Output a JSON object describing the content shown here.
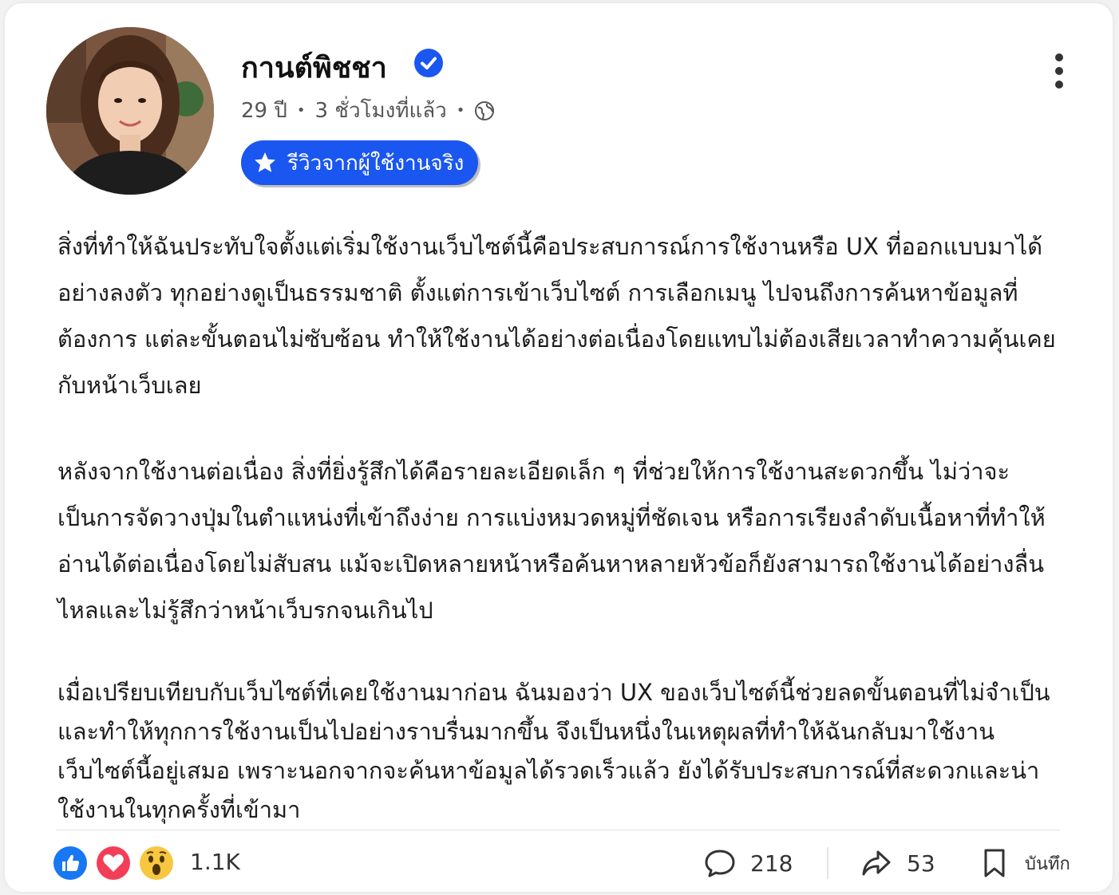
{
  "post": {
    "author_name": "กานต์พิชชา",
    "age": "29 ปี",
    "time_ago": "3 ชั่วโมงที่แล้ว",
    "separator": "•",
    "badge_label": "รีวิวจากผู้ใช้งานจริง",
    "paragraphs": [
      "สิ่งที่ทำให้ฉันประทับใจตั้งแต่เริ่มใช้งานเว็บไซต์นี้คือประสบการณ์การใช้งานหรือ UX ที่ออกแบบมาได้อย่างลงตัว ทุกอย่างดูเป็นธรรมชาติ ตั้งแต่การเข้าเว็บไซต์ การเลือกเมนู ไปจนถึงการค้นหาข้อมูลที่ต้องการ แต่ละขั้นตอนไม่ซับซ้อน ทำให้ใช้งานได้อย่างต่อเนื่องโดยแทบไม่ต้องเสียเวลาทำความคุ้นเคยกับหน้าเว็บเลย",
      "หลังจากใช้งานต่อเนื่อง สิ่งที่ยิ่งรู้สึกได้คือรายละเอียดเล็ก ๆ ที่ช่วยให้การใช้งานสะดวกขึ้น ไม่ว่าจะเป็นการจัดวางปุ่มในตำแหน่งที่เข้าถึงง่าย การแบ่งหมวดหมู่ที่ชัดเจน หรือการเรียงลำดับเนื้อหาที่ทำให้อ่านได้ต่อเนื่องโดยไม่สับสน แม้จะเปิดหลายหน้าหรือค้นหาหลายหัวข้อก็ยังสามารถใช้งานได้อย่างลื่นไหลและไม่รู้สึกว่าหน้าเว็บรกจนเกินไป",
      "เมื่อเปรียบเทียบกับเว็บไซต์ที่เคยใช้งานมาก่อน ฉันมองว่า UX ของเว็บไซต์นี้ช่วยลดขั้นตอนที่ไม่จำเป็น และทำให้ทุกการใช้งานเป็นไปอย่างราบรื่นมากขึ้น จึงเป็นหนึ่งในเหตุผลที่ทำให้ฉันกลับมาใช้งานเว็บไซต์นี้อยู่เสมอ เพราะนอกจากจะค้นหาข้อมูลได้รวดเร็วแล้ว ยังได้รับประสบการณ์ที่สะดวกและน่าใช้งานในทุกครั้งที่เข้ามา"
    ]
  },
  "footer": {
    "reaction_count": "1.1K",
    "comment_count": "218",
    "share_count": "53",
    "save_label": "บันทึก"
  },
  "colors": {
    "accent": "#1a56f0",
    "like": "#1877f2",
    "love": "#f33e58",
    "wow": "#f7c741"
  },
  "icons": {
    "verified": "verified-check-icon",
    "globe": "globe-icon",
    "star": "star-icon",
    "more": "more-vertical-icon",
    "comment": "comment-icon",
    "share": "share-icon",
    "bookmark": "bookmark-icon"
  }
}
